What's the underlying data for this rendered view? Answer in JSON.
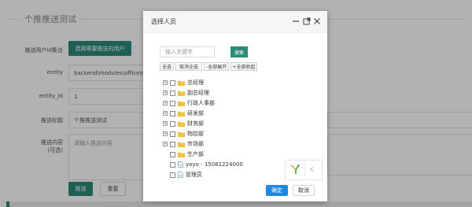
{
  "page": {
    "title": "个推推送测试",
    "fields": [
      {
        "label": "推送用户id集合",
        "button": "选择需要推送的用户"
      },
      {
        "label": "entity",
        "value": "backend\\modules\\office\\models\\"
      },
      {
        "label": "entity_id",
        "value": "1"
      },
      {
        "label": "推送标题",
        "value": "个推推送测试"
      },
      {
        "label": "推送内容\n(可选)",
        "placeholder": "请输入推送内容"
      }
    ],
    "submit_label": "推送",
    "reset_label": "重置"
  },
  "modal": {
    "title": "选择人员",
    "search_placeholder": "输入关键字",
    "search_button": "搜索",
    "toolbar": [
      "全选",
      "取消全选",
      "-全部展开",
      "+全部收起"
    ],
    "tree": [
      {
        "label": "总经理",
        "expandable": true,
        "icon": "folder-icon"
      },
      {
        "label": "副总经理",
        "expandable": true,
        "icon": "folder-icon"
      },
      {
        "label": "行政人事部",
        "expandable": true,
        "icon": "folder-icon"
      },
      {
        "label": "研发部",
        "expandable": true,
        "icon": "folder-icon"
      },
      {
        "label": "财务部",
        "expandable": true,
        "icon": "folder-icon"
      },
      {
        "label": "物控部",
        "expandable": true,
        "icon": "folder-icon"
      },
      {
        "label": "市场部",
        "expandable": true,
        "icon": "folder-icon"
      },
      {
        "label": "生产部",
        "expandable": false,
        "icon": "folder-icon"
      },
      {
        "label": "yoyo - 15061224000",
        "expandable": false,
        "icon": "file-icon"
      },
      {
        "label": "管理员",
        "expandable": false,
        "icon": "file-icon"
      }
    ],
    "confirm_label": "确定",
    "cancel_label": "取消"
  },
  "colors": {
    "accent_green": "#2b8a78",
    "confirm_blue": "#1e88e5",
    "folder_yellow": "#f5c542"
  }
}
